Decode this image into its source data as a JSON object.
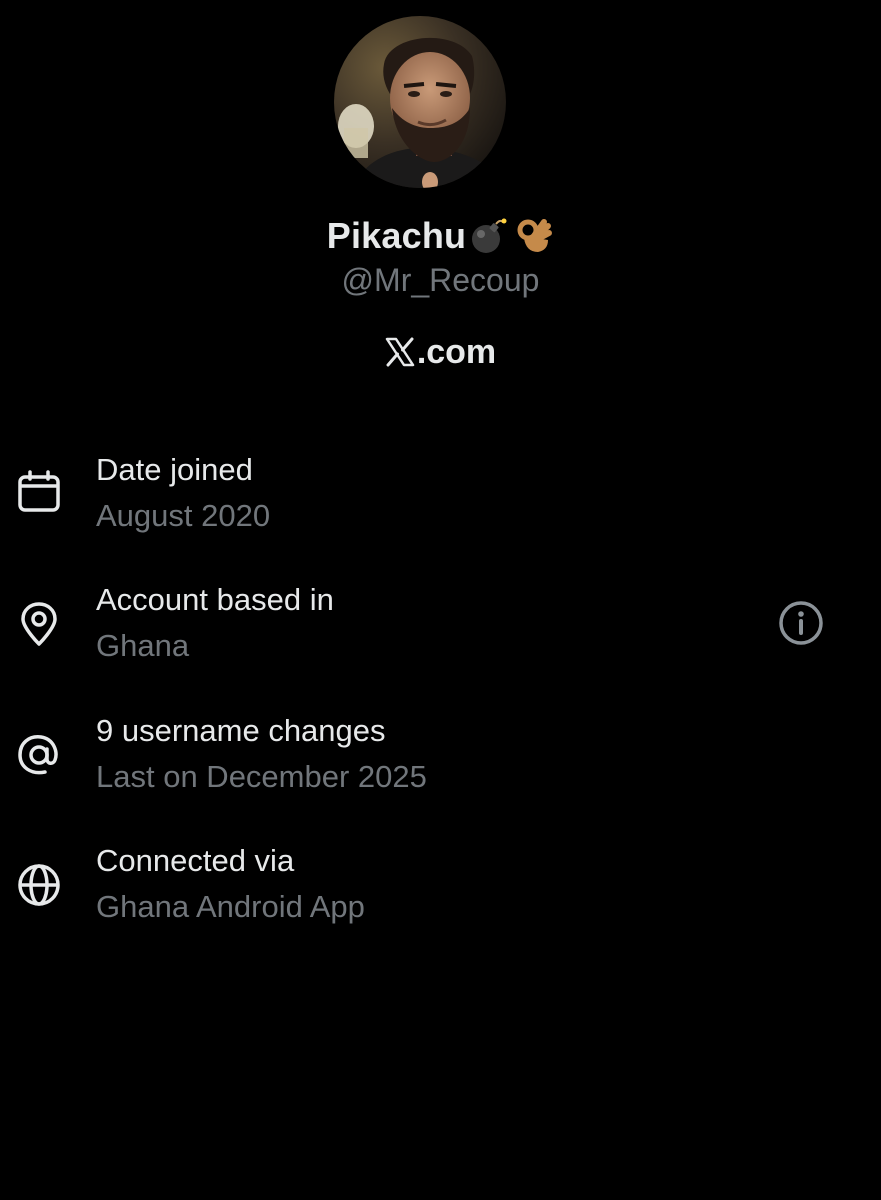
{
  "profile": {
    "display_name": "Pikachu",
    "handle": "@Mr_Recoup",
    "site_name": ".com"
  },
  "icons": {
    "avatar": "profile-photo",
    "name_emojis": [
      "bomb-emoji",
      "ok-hand-emoji"
    ],
    "site_logo": "x-logo-icon"
  },
  "about": [
    {
      "icon": "calendar-icon",
      "title": "Date joined",
      "value": "August 2020"
    },
    {
      "icon": "location-pin-icon",
      "title": "Account based in",
      "value": "Ghana",
      "trailing_icon": "info-icon"
    },
    {
      "icon": "at-sign-icon",
      "title": "9 username changes",
      "value": "Last on December 2025"
    },
    {
      "icon": "globe-icon",
      "title": "Connected via",
      "value": "Ghana Android App"
    }
  ],
  "colors": {
    "background": "#000000",
    "primary_text": "#e7e9ea",
    "secondary_text": "#71767b"
  }
}
